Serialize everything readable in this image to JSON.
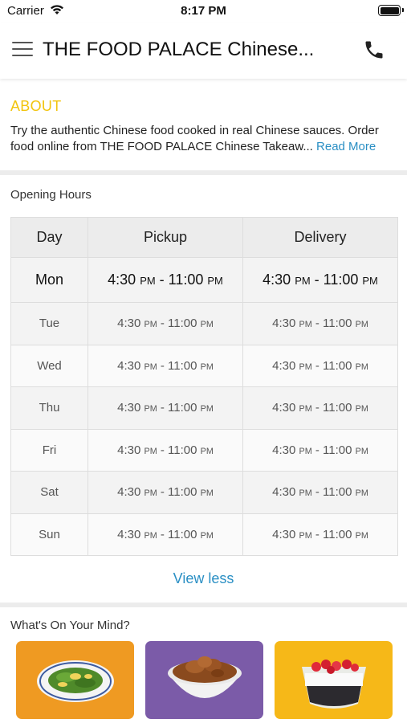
{
  "status_bar": {
    "carrier": "Carrier",
    "time": "8:17 PM"
  },
  "header": {
    "title": "THE FOOD PALACE Chinese...",
    "menu_icon": "hamburger-menu-icon",
    "call_icon": "phone-icon"
  },
  "about": {
    "title": "ABOUT",
    "text": "Try the authentic Chinese food cooked in real Chinese sauces. Order food online from THE FOOD PALACE Chinese Takeaw...",
    "read_more": "Read More"
  },
  "opening_hours": {
    "title": "Opening Hours",
    "headers": {
      "day": "Day",
      "pickup": "Pickup",
      "delivery": "Delivery"
    },
    "rows": [
      {
        "day": "Mon",
        "pickup_open": "4:30",
        "pickup_close": "11:00",
        "delivery_open": "4:30",
        "delivery_close": "11:00"
      },
      {
        "day": "Tue",
        "pickup_open": "4:30",
        "pickup_close": "11:00",
        "delivery_open": "4:30",
        "delivery_close": "11:00"
      },
      {
        "day": "Wed",
        "pickup_open": "4:30",
        "pickup_close": "11:00",
        "delivery_open": "4:30",
        "delivery_close": "11:00"
      },
      {
        "day": "Thu",
        "pickup_open": "4:30",
        "pickup_close": "11:00",
        "delivery_open": "4:30",
        "delivery_close": "11:00"
      },
      {
        "day": "Fri",
        "pickup_open": "4:30",
        "pickup_close": "11:00",
        "delivery_open": "4:30",
        "delivery_close": "11:00"
      },
      {
        "day": "Sat",
        "pickup_open": "4:30",
        "pickup_close": "11:00",
        "delivery_open": "4:30",
        "delivery_close": "11:00"
      },
      {
        "day": "Sun",
        "pickup_open": "4:30",
        "pickup_close": "11:00",
        "delivery_open": "4:30",
        "delivery_close": "11:00"
      }
    ],
    "ampm_open": "PM",
    "ampm_close": "PM",
    "separator": " - ",
    "view_less": "View less"
  },
  "whats_on_your_mind": {
    "title": "What's On Your Mind?",
    "cards": [
      {
        "icon": "stir-fry-plate-icon",
        "color": "#ef9a22"
      },
      {
        "icon": "curry-bowl-icon",
        "color": "#7b5ba8"
      },
      {
        "icon": "dessert-bowl-icon",
        "color": "#f6b818"
      }
    ]
  },
  "colors": {
    "accent_yellow": "#f2c40d",
    "link_blue": "#2a8fc4"
  }
}
